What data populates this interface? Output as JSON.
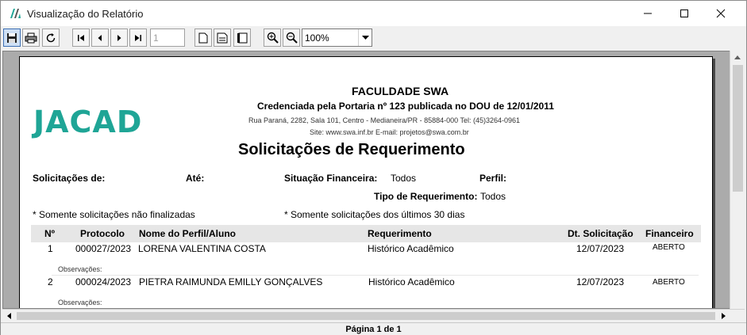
{
  "window": {
    "title": "Visualização do Relatório"
  },
  "toolbar": {
    "page_value": "1",
    "zoom_value": "100%"
  },
  "report": {
    "institution": "FACULDADE SWA",
    "accreditation": "Credenciada pela Portaria nº 123 publicada no DOU de 12/01/2011",
    "address": "Rua Paraná, 2282, Sala 101, Centro - Medianeira/PR - 85884-000 Tel: (45)3264-0961",
    "site": "Site: www.swa.inf.br   E-mail: projetos@swa.com.br",
    "logo_text": "JACAD",
    "report_title": "Solicitações de Requerimento",
    "filters": {
      "solicitacoes_de_label": "Solicitações de:",
      "ate_label": "Até:",
      "situacao_label": "Situação Financeira:",
      "situacao_value": "Todos",
      "perfil_label": "Perfil:",
      "tipo_label": "Tipo de Requerimento:",
      "tipo_value": "Todos"
    },
    "notes": {
      "left": "* Somente solicitações não finalizadas",
      "right": "* Somente solicitações dos últimos 30 dias"
    },
    "columns": [
      "Nº",
      "Protocolo",
      "Nome do Perfil/Aluno",
      "Requerimento",
      "Dt. Solicitação",
      "Financeiro"
    ],
    "rows": [
      {
        "num": "1",
        "protocolo": "000027/2023",
        "nome": "LORENA VALENTINA COSTA",
        "requerimento": "Histórico Acadêmico",
        "data": "12/07/2023",
        "financeiro": "ABERTO",
        "obs": "Observações:"
      },
      {
        "num": "2",
        "protocolo": "000024/2023",
        "nome": "PIETRA RAIMUNDA EMILLY GONÇALVES",
        "requerimento": "Histórico Acadêmico",
        "data": "12/07/2023",
        "financeiro": "ABERTO",
        "obs": "Observações:"
      }
    ]
  },
  "status": {
    "page_indicator": "Página 1 de 1"
  }
}
